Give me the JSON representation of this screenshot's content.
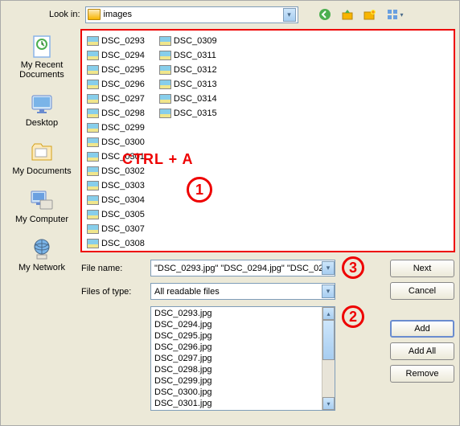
{
  "lookin": {
    "label": "Look in:",
    "value": "images"
  },
  "places": [
    {
      "label": "My Recent Documents"
    },
    {
      "label": "Desktop"
    },
    {
      "label": "My Documents"
    },
    {
      "label": "My Computer"
    },
    {
      "label": "My Network"
    }
  ],
  "files_col1": [
    "DSC_0293",
    "DSC_0294",
    "DSC_0295",
    "DSC_0296",
    "DSC_0297",
    "DSC_0298",
    "DSC_0299",
    "DSC_0300",
    "DSC_0301",
    "DSC_0302",
    "DSC_0303",
    "DSC_0304",
    "DSC_0305",
    "DSC_0307",
    "DSC_0308"
  ],
  "files_col2": [
    "DSC_0309",
    "DSC_0311",
    "DSC_0312",
    "DSC_0313",
    "DSC_0314",
    "DSC_0315"
  ],
  "annot": {
    "ctrla": "CTRL + A",
    "n1": "1",
    "n2": "2",
    "n3": "3"
  },
  "filename": {
    "label": "File name:",
    "value": "\"DSC_0293.jpg\" \"DSC_0294.jpg\" \"DSC_0295."
  },
  "filetype": {
    "label": "Files of type:",
    "value": "All readable files"
  },
  "added": [
    "DSC_0293.jpg",
    "DSC_0294.jpg",
    "DSC_0295.jpg",
    "DSC_0296.jpg",
    "DSC_0297.jpg",
    "DSC_0298.jpg",
    "DSC_0299.jpg",
    "DSC_0300.jpg",
    "DSC_0301.jpg"
  ],
  "buttons": {
    "next": "Next",
    "cancel": "Cancel",
    "add": "Add",
    "addall": "Add All",
    "remove": "Remove"
  }
}
